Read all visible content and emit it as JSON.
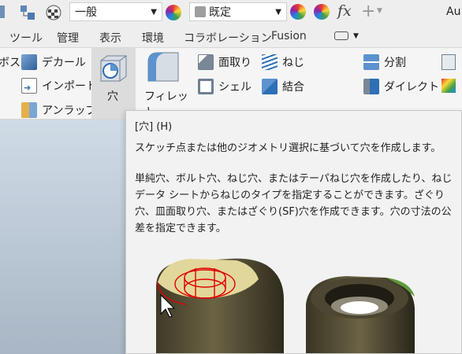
{
  "toolbar": {
    "combo_appearance": "一般",
    "combo_material": "既定",
    "fx_label": "fx",
    "plus_label": "+",
    "app_abbrev": "Au"
  },
  "tabs": [
    "ツール",
    "管理",
    "表示",
    "環境",
    "コラボレーション",
    "Fusion"
  ],
  "ribbon": {
    "left_cut": "ボス",
    "decal": "デカール",
    "import": "インポート",
    "unwrap": "アンラップ",
    "hole": "穴",
    "fillet": "フィレット",
    "chamfer": "面取り",
    "thread": "ねじ",
    "shell": "シェル",
    "combine": "結合",
    "split": "分割",
    "direct": "ダイレクト"
  },
  "tooltip": {
    "title": "[穴] (H)",
    "summary": "スケッチ点または他のジオメトリ選択に基づいて穴を作成します。",
    "body": "単純穴、ボルト穴、ねじ穴、またはテーパねじ穴を作成したり、ねじデータ シートからねじのタイプを指定することができます。ざぐり穴、皿面取り穴、またはざぐり(SF)穴を作成できます。穴の寸法の公差を指定できます。"
  },
  "colors": {
    "ribbon_bg": "#f5f5f5",
    "tooltip_bg": "#f2f2f2",
    "highlight_red": "#e00000",
    "part_face": "#e2d79a",
    "part_body": "#5a5338"
  }
}
